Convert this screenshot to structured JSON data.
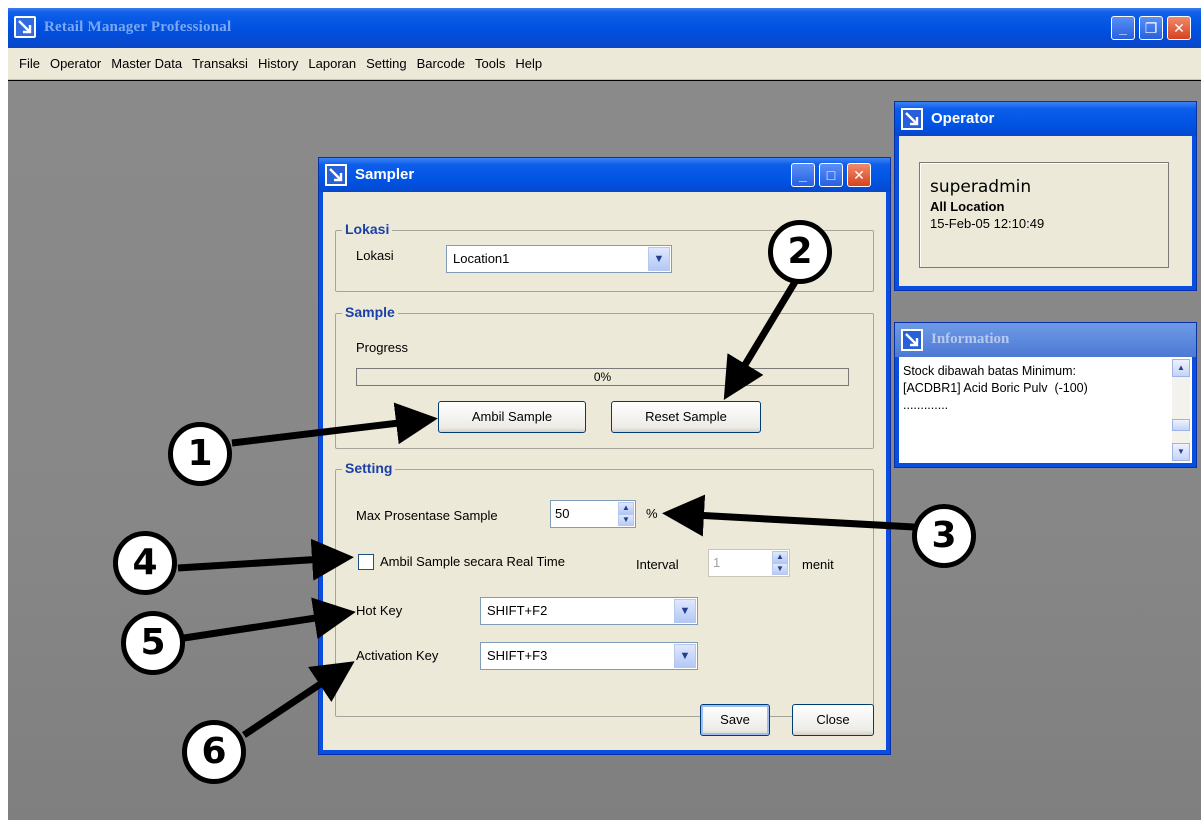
{
  "app": {
    "title": "Retail Manager Professional",
    "menu": [
      "File",
      "Operator",
      "Master Data",
      "Transaksi",
      "History",
      "Laporan",
      "Setting",
      "Barcode",
      "Tools",
      "Help"
    ]
  },
  "sampler": {
    "title": "Sampler",
    "lokasi_group": "Lokasi",
    "lokasi_label": "Lokasi",
    "lokasi_value": "Location1",
    "sample_group": "Sample",
    "progress_label": "Progress",
    "progress_text": "0%",
    "progress_fraction": 0,
    "ambil_sample": "Ambil Sample",
    "reset_sample": "Reset Sample",
    "setting_group": "Setting",
    "max_label": "Max Prosentase Sample",
    "max_value": "50",
    "percent_sign": "%",
    "realtime_label": "Ambil Sample secara Real Time",
    "realtime_checked": false,
    "interval_label": "Interval",
    "interval_value": "1",
    "menit_label": "menit",
    "hotkey_label": "Hot Key",
    "hotkey_value": "SHIFT+F2",
    "activation_label": "Activation Key",
    "activation_value": "SHIFT+F3",
    "save": "Save",
    "close": "Close"
  },
  "operator": {
    "title": "Operator",
    "user": "superadmin",
    "location": "All Location",
    "datetime": "15-Feb-05 12:10:49"
  },
  "information": {
    "title": "Information",
    "line1": "Stock dibawah batas Minimum:",
    "line2": "[ACDBR1] Acid Boric Pulv  (-100)",
    "line3": "............."
  },
  "callouts": [
    "1",
    "2",
    "3",
    "4",
    "5",
    "6"
  ],
  "icons": {
    "window_icon": "app-arrow-icon",
    "minimize": "minimize-icon",
    "maximize": "maximize-icon",
    "restore": "restore-icon",
    "close": "close-icon",
    "dropdown": "chevron-down-icon"
  },
  "colors": {
    "titlebar": "#0052e2",
    "dialog_face": "#ece9d8",
    "group_title": "#1c3fa8",
    "desktop": "#878787"
  }
}
